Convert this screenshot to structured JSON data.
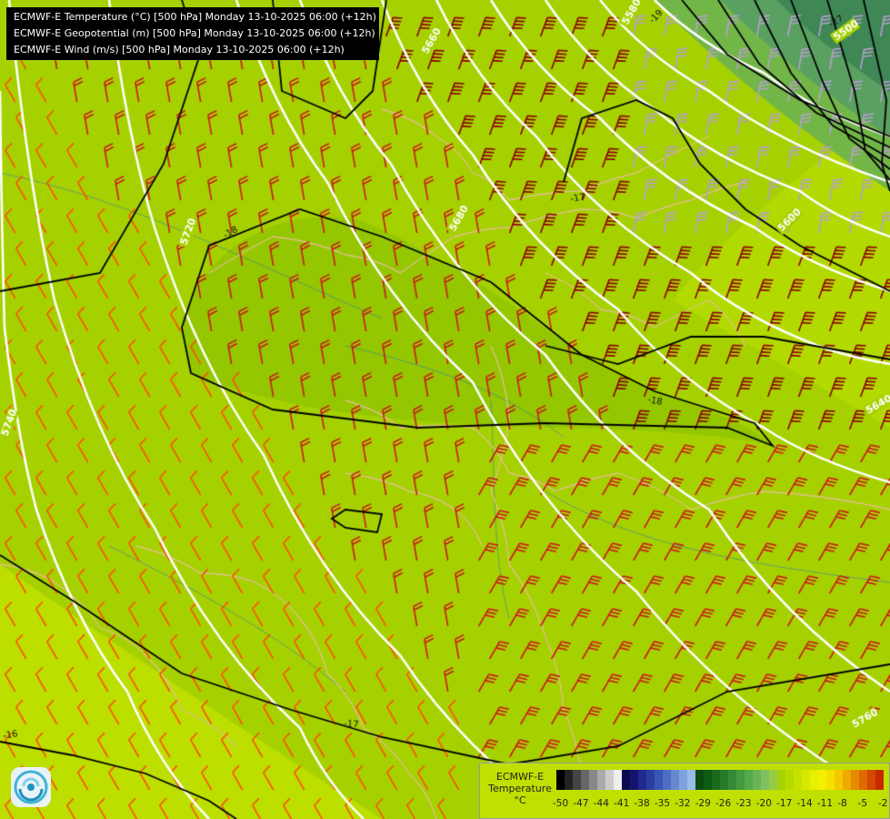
{
  "titles": [
    "ECMWF-E Temperature (°C) [500 hPa] Monday 13-10-2025 06:00 (+12h)",
    "ECMWF-E Geopotential (m) [500 hPa] Monday 13-10-2025 06:00 (+12h)",
    "ECMWF-E Wind (m/s) [500 hPa] Monday 13-10-2025 06:00 (+12h)"
  ],
  "legend": {
    "line1": "ECMWF-E",
    "line2": "Temperature",
    "unit": "°C",
    "ticks": [
      "-50",
      "-47",
      "-44",
      "-41",
      "-38",
      "-35",
      "-32",
      "-29",
      "-26",
      "-23",
      "-20",
      "-17",
      "-14",
      "-11",
      "-8",
      "-5",
      "-2"
    ],
    "colors": [
      "#000000",
      "#222222",
      "#444444",
      "#666666",
      "#888888",
      "#aaaaaa",
      "#cccccc",
      "#eeeeee",
      "#0a0a50",
      "#14146e",
      "#1e2a8c",
      "#2a3ea0",
      "#3a56b4",
      "#4e6ec4",
      "#6488d2",
      "#7ea2de",
      "#98bce8",
      "#0a4a0a",
      "#0f5a12",
      "#1a6a1c",
      "#267a28",
      "#348a34",
      "#449a40",
      "#56aa4c",
      "#6ab458",
      "#80c060",
      "#96ca4a",
      "#a6d200",
      "#b6da00",
      "#c6e200",
      "#d6ea00",
      "#e6f000",
      "#f2f000",
      "#f6e000",
      "#f4c800",
      "#eeaa00",
      "#e68a00",
      "#de6a00",
      "#d44a00",
      "#c82a00",
      "#b00010",
      "#a00030",
      "#8a0060",
      "#7a0090",
      "#9a10c8",
      "#6a1aa0",
      "#4a1070",
      "#2a0840"
    ]
  },
  "contour_labels": {
    "geopotential": [
      "5580",
      "5660",
      "5680",
      "5600",
      "5640",
      "5720",
      "5740",
      "5760",
      "5500"
    ],
    "temperature": [
      "-19",
      "-17",
      "-18",
      "-18",
      "-17",
      "-16",
      "-27"
    ]
  },
  "map_colors": {
    "background": "#a6d100",
    "warm_band": "#bcdf00",
    "cold_core_1": "#73b648",
    "cold_core_2": "#5aa061",
    "cold_core_3": "#3f8755",
    "inner_region": "#94c700",
    "borders": "#e0c090",
    "rivers": "#2a7ab0",
    "isohypse": "#ffffff",
    "isotherm": "#000000",
    "barbs_warm": "#ff5000",
    "barbs_mid": "#cc1a1a",
    "barbs_strong": "#8c0000",
    "barbs_cold": "#b4a0cc"
  },
  "icons": {
    "logo": "ecmwf-swirl-logo-icon"
  }
}
